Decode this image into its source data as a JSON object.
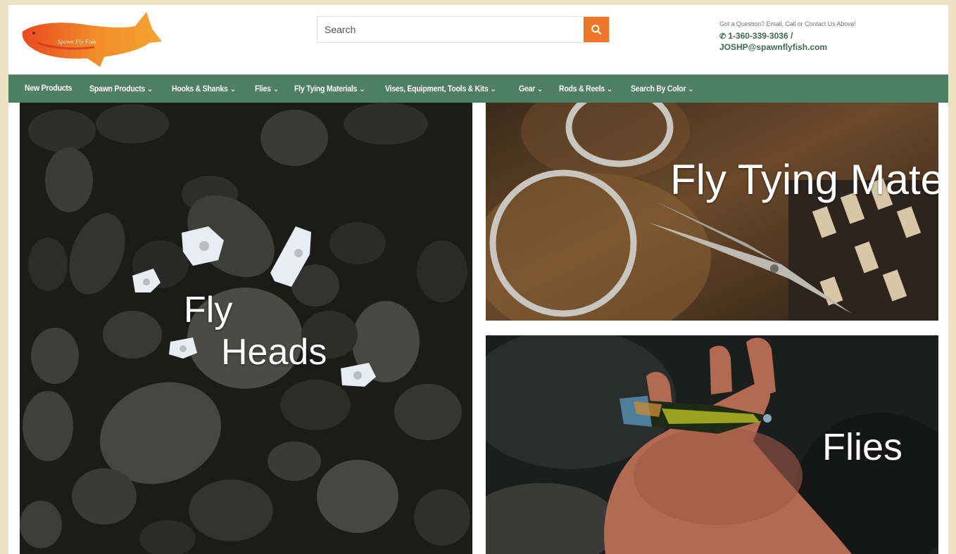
{
  "header": {
    "logo_text": "Spawn Fly Fish",
    "search": {
      "placeholder": "Search",
      "button_icon": "search-icon"
    },
    "contact": {
      "question": "Got a Question? Email, Call or Contact Us Above!",
      "phone": "1-360-339-3036 /",
      "email": "JOSHP@spawnflyfish.com"
    }
  },
  "nav": {
    "items": [
      {
        "label": "New Products",
        "dropdown": false
      },
      {
        "label": "Spawn Products",
        "dropdown": true
      },
      {
        "label": "Hooks & Shanks",
        "dropdown": true
      },
      {
        "label": "Flies",
        "dropdown": true
      },
      {
        "label": "Fly Tying Materials",
        "dropdown": true
      },
      {
        "label": "Vises, Equipment, Tools & Kits",
        "dropdown": true
      },
      {
        "label": "Gear",
        "dropdown": true
      },
      {
        "label": "Rods & Reels",
        "dropdown": true
      },
      {
        "label": "Search By Color",
        "dropdown": true
      }
    ]
  },
  "tiles": {
    "fly_heads": {
      "line1": "Fly",
      "line2": "Heads"
    },
    "fly_tying_materials": {
      "title": "Fly Tying Materials"
    },
    "flies": {
      "title": "Flies"
    }
  },
  "colors": {
    "accent_orange": "#ee7629",
    "nav_green": "#4e7e63",
    "contact_green": "#3d6a52",
    "page_background": "#ede2c4"
  }
}
